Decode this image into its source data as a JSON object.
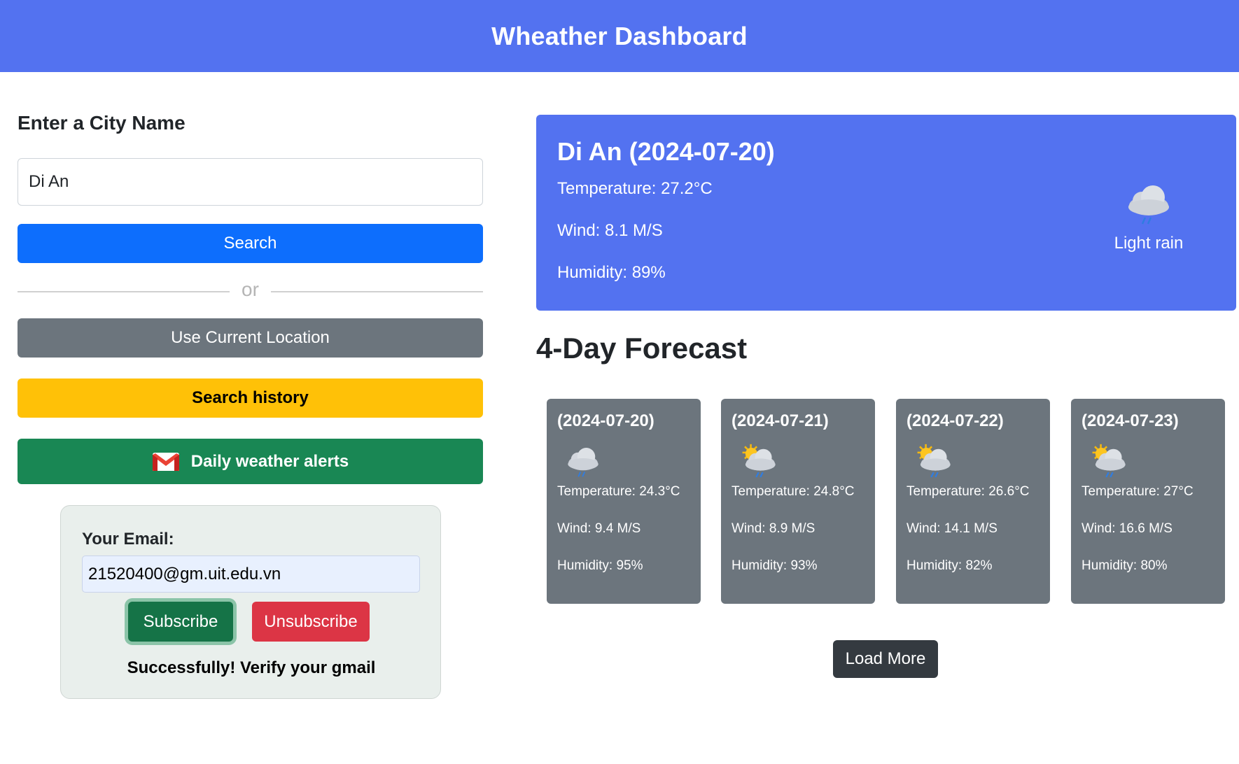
{
  "header": {
    "title": "Wheather Dashboard"
  },
  "search": {
    "label": "Enter a City Name",
    "value": "Di An",
    "search_button": "Search",
    "divider_text": "or",
    "location_button": "Use Current Location",
    "history_button": "Search history",
    "alerts_button": "Daily weather alerts"
  },
  "subscription": {
    "email_label": "Your Email:",
    "email_value": "21520400@gm.uit.edu.vn",
    "subscribe_button": "Subscribe",
    "unsubscribe_button": "Unsubscribe",
    "status": "Successfully! Verify your gmail"
  },
  "current": {
    "title": "Di An (2024-07-20)",
    "temperature": "Temperature: 27.2°C",
    "wind": "Wind: 8.1 M/S",
    "humidity": "Humidity: 89%",
    "description": "Light rain",
    "icon": "light-rain-cloud-icon"
  },
  "forecast": {
    "title": "4-Day Forecast",
    "days": [
      {
        "date": "(2024-07-20)",
        "icon": "light-rain-cloud-icon",
        "temperature": "Temperature: 24.3°C",
        "wind": "Wind: 9.4 M/S",
        "humidity": "Humidity: 95%"
      },
      {
        "date": "(2024-07-21)",
        "icon": "sun-cloud-rain-icon",
        "temperature": "Temperature: 24.8°C",
        "wind": "Wind: 8.9 M/S",
        "humidity": "Humidity: 93%"
      },
      {
        "date": "(2024-07-22)",
        "icon": "sun-cloud-rain-icon",
        "temperature": "Temperature: 26.6°C",
        "wind": "Wind: 14.1 M/S",
        "humidity": "Humidity: 82%"
      },
      {
        "date": "(2024-07-23)",
        "icon": "sun-cloud-rain-icon",
        "temperature": "Temperature: 27°C",
        "wind": "Wind: 16.6 M/S",
        "humidity": "Humidity: 80%"
      }
    ],
    "load_more_button": "Load More"
  },
  "colors": {
    "primary": "#5372f0",
    "search": "#0d6efd",
    "secondary": "#6c757d",
    "warning": "#ffc107",
    "success": "#198754",
    "danger": "#dc3545",
    "dark": "#343a40"
  }
}
